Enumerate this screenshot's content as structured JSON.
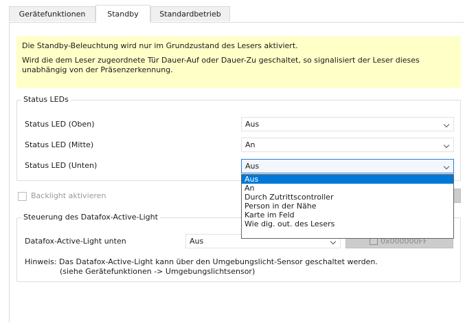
{
  "tabs": [
    {
      "label": "Gerätefunktionen"
    },
    {
      "label": "Standby"
    },
    {
      "label": "Standardbetrieb"
    }
  ],
  "info": {
    "line1": "Die Standby-Beleuchtung wird nur im Grundzustand des Lesers aktiviert.",
    "line2": "Wird die dem Leser zugeordnete Tür Dauer-Auf oder Dauer-Zu geschaltet, so signalisiert der Leser dieses unabhängig von der Präsenzerkennung."
  },
  "status_leds": {
    "title": "Status LEDs",
    "rows": [
      {
        "label": "Status LED (Oben)",
        "value": "Aus"
      },
      {
        "label": "Status LED (Mitte)",
        "value": "An"
      },
      {
        "label": "Status LED (Unten)",
        "value": "Aus"
      }
    ]
  },
  "dropdown": {
    "options": [
      "Aus",
      "An",
      "Durch Zutrittscontroller",
      "Person in der Nähe",
      "Karte im Feld",
      "Wie dig. out. des Lesers"
    ],
    "selected": "Aus"
  },
  "backlight": {
    "label": "Backlight aktivieren",
    "checked": false
  },
  "active_light": {
    "title": "Steuerung des Datafox-Active-Light",
    "label": "Datafox-Active-Light unten",
    "value": "Aus",
    "color_value": "0x000000FF",
    "hint_line1": "Hinweis: Das Datafox-Active-Light kann über den Umgebungslicht-Sensor geschaltet werden.",
    "hint_line2": "(siehe Gerätefunktionen -> Umgebungslichtsensor)"
  },
  "colors": {
    "info_background": "#ffffc8",
    "selection": "#0078d7",
    "focus_border": "#2e7bd6"
  }
}
